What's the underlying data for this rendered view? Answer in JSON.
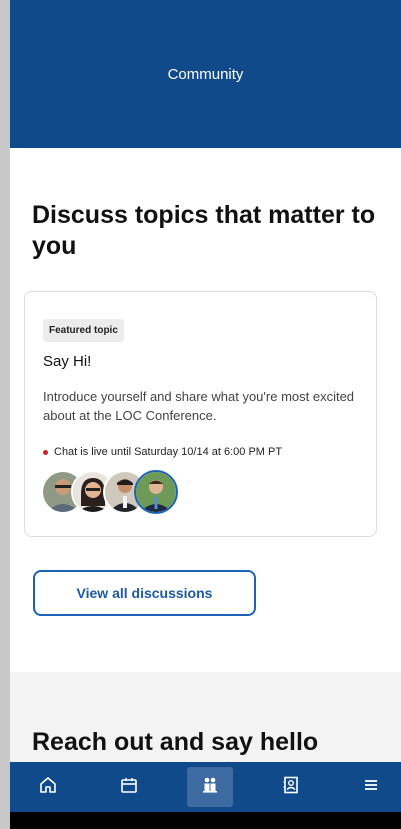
{
  "header": {
    "title": "Community"
  },
  "discuss": {
    "title": "Discuss topics that matter to you"
  },
  "featured": {
    "badge": "Featured topic",
    "title": "Say Hi!",
    "description": "Introduce yourself and share what you're most excited about at the LOC Conference.",
    "live_status": "Chat is live until Saturday 10/14 at 6:00 PM PT",
    "live_color": "#d42020"
  },
  "actions": {
    "view_all": "View all discussions"
  },
  "reach_out": {
    "title": "Reach out and say hello"
  },
  "bottom_nav": {
    "items": [
      {
        "icon": "home-icon",
        "active": false
      },
      {
        "icon": "calendar-icon",
        "active": false
      },
      {
        "icon": "community-icon",
        "active": true
      },
      {
        "icon": "contacts-icon",
        "active": false
      },
      {
        "icon": "menu-icon",
        "active": false
      }
    ]
  },
  "colors": {
    "brand": "#114a8a",
    "accent": "#1c63b8"
  }
}
